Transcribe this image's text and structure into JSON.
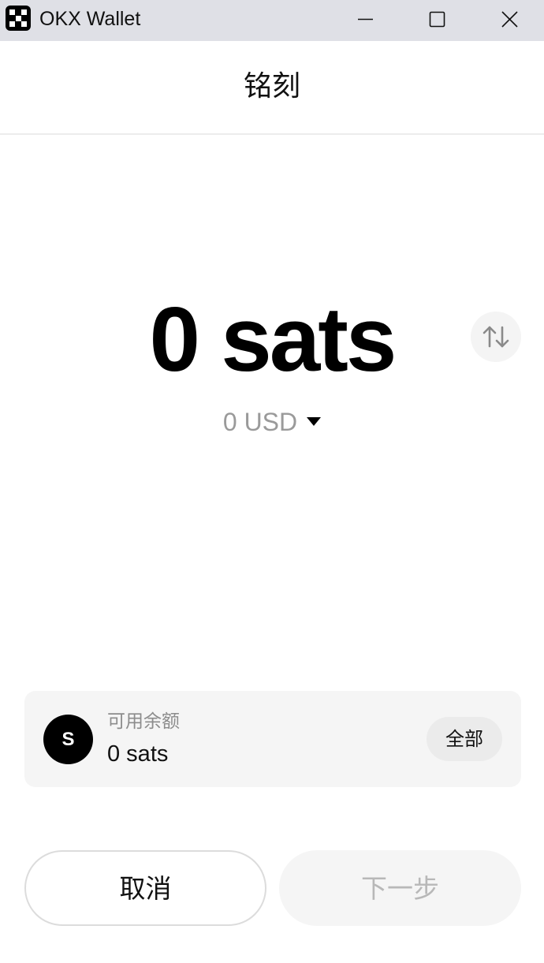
{
  "window": {
    "title": "OKX Wallet"
  },
  "header": {
    "title": "铭刻"
  },
  "amount": {
    "value": "0 sats",
    "fiat": "0 USD"
  },
  "balance": {
    "avatar_letter": "S",
    "label": "可用余额",
    "value": "0 sats",
    "all_label": "全部"
  },
  "actions": {
    "cancel_label": "取消",
    "next_label": "下一步"
  },
  "icons": {
    "app_logo": "okx-logo",
    "minimize": "minimize-icon",
    "maximize": "maximize-icon",
    "close": "close-icon",
    "swap": "swap-vertical-icon",
    "dropdown": "caret-down-icon"
  },
  "colors": {
    "titlebar": "#dfe0e6",
    "card": "#f5f5f5",
    "muted_text": "#9a9a9a",
    "disabled_text": "#b8b8b8"
  }
}
